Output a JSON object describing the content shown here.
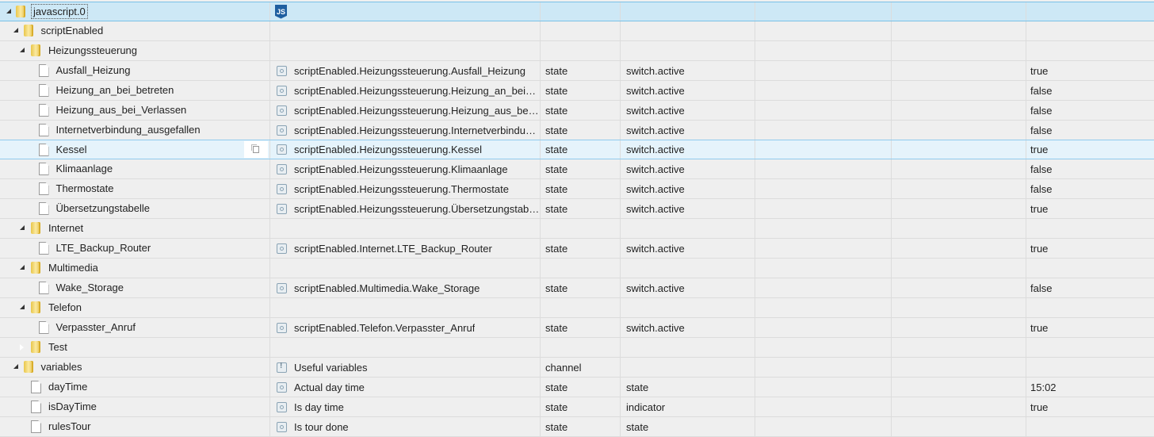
{
  "rows": [
    {
      "level": 0,
      "kind": "folder",
      "expand": "open",
      "id": "javascript.0",
      "icon": "js",
      "selected": "root",
      "name": "",
      "type": "",
      "role": "",
      "value": ""
    },
    {
      "level": 1,
      "kind": "folder",
      "expand": "open",
      "id": "scriptEnabled",
      "name": "",
      "type": "",
      "role": "",
      "value": ""
    },
    {
      "level": 2,
      "kind": "folder",
      "expand": "open",
      "id": "Heizungssteuerung",
      "name": "",
      "type": "",
      "role": "",
      "value": ""
    },
    {
      "level": 3,
      "kind": "file",
      "id": "Ausfall_Heizung",
      "icon": "state",
      "name": "scriptEnabled.Heizungssteuerung.Ausfall_Heizung",
      "type": "state",
      "role": "switch.active",
      "value": "true"
    },
    {
      "level": 3,
      "kind": "file",
      "id": "Heizung_an_bei_betreten",
      "icon": "state",
      "name": "scriptEnabled.Heizungssteuerung.Heizung_an_bei_b...",
      "type": "state",
      "role": "switch.active",
      "value": "false"
    },
    {
      "level": 3,
      "kind": "file",
      "id": "Heizung_aus_bei_Verlassen",
      "icon": "state",
      "name": "scriptEnabled.Heizungssteuerung.Heizung_aus_bei_...",
      "type": "state",
      "role": "switch.active",
      "value": "false"
    },
    {
      "level": 3,
      "kind": "file",
      "id": "Internetverbindung_ausgefallen",
      "icon": "state",
      "name": "scriptEnabled.Heizungssteuerung.Internetverbindun...",
      "type": "state",
      "role": "switch.active",
      "value": "false"
    },
    {
      "level": 3,
      "kind": "file",
      "id": "Kessel",
      "icon": "state",
      "selected": "sel",
      "copy": true,
      "name": "scriptEnabled.Heizungssteuerung.Kessel",
      "type": "state",
      "role": "switch.active",
      "value": "true"
    },
    {
      "level": 3,
      "kind": "file",
      "id": "Klimaanlage",
      "icon": "state",
      "name": "scriptEnabled.Heizungssteuerung.Klimaanlage",
      "type": "state",
      "role": "switch.active",
      "value": "false"
    },
    {
      "level": 3,
      "kind": "file",
      "id": "Thermostate",
      "icon": "state",
      "name": "scriptEnabled.Heizungssteuerung.Thermostate",
      "type": "state",
      "role": "switch.active",
      "value": "false"
    },
    {
      "level": 3,
      "kind": "file",
      "id": "Übersetzungstabelle",
      "icon": "state",
      "name": "scriptEnabled.Heizungssteuerung.Übersetzungstabe...",
      "type": "state",
      "role": "switch.active",
      "value": "true"
    },
    {
      "level": 2,
      "kind": "folder",
      "expand": "open",
      "id": "Internet",
      "name": "",
      "type": "",
      "role": "",
      "value": ""
    },
    {
      "level": 3,
      "kind": "file",
      "id": "LTE_Backup_Router",
      "icon": "state",
      "name": "scriptEnabled.Internet.LTE_Backup_Router",
      "type": "state",
      "role": "switch.active",
      "value": "true"
    },
    {
      "level": 2,
      "kind": "folder",
      "expand": "open",
      "id": "Multimedia",
      "name": "",
      "type": "",
      "role": "",
      "value": ""
    },
    {
      "level": 3,
      "kind": "file",
      "id": "Wake_Storage",
      "icon": "state",
      "name": "scriptEnabled.Multimedia.Wake_Storage",
      "type": "state",
      "role": "switch.active",
      "value": "false"
    },
    {
      "level": 2,
      "kind": "folder",
      "expand": "open",
      "id": "Telefon",
      "name": "",
      "type": "",
      "role": "",
      "value": ""
    },
    {
      "level": 3,
      "kind": "file",
      "id": "Verpasster_Anruf",
      "icon": "state",
      "name": "scriptEnabled.Telefon.Verpasster_Anruf",
      "type": "state",
      "role": "switch.active",
      "value": "true"
    },
    {
      "level": 2,
      "kind": "folder",
      "expand": "closed",
      "id": "Test",
      "name": "",
      "type": "",
      "role": "",
      "value": ""
    },
    {
      "level": 1,
      "kind": "folder",
      "expand": "open",
      "id": "variables",
      "icon": "channel",
      "name": "Useful variables",
      "type": "channel",
      "role": "",
      "value": ""
    },
    {
      "level": 2,
      "kind": "file",
      "id": "dayTime",
      "icon": "state",
      "name": "Actual day time",
      "type": "state",
      "role": "state",
      "value": "15:02"
    },
    {
      "level": 2,
      "kind": "file",
      "id": "isDayTime",
      "icon": "state",
      "name": "Is day time",
      "type": "state",
      "role": "indicator",
      "value": "true"
    },
    {
      "level": 2,
      "kind": "file",
      "id": "rulesTour",
      "icon": "state",
      "name": "Is tour done",
      "type": "state",
      "role": "state",
      "value": ""
    }
  ],
  "js_badge": "JS"
}
